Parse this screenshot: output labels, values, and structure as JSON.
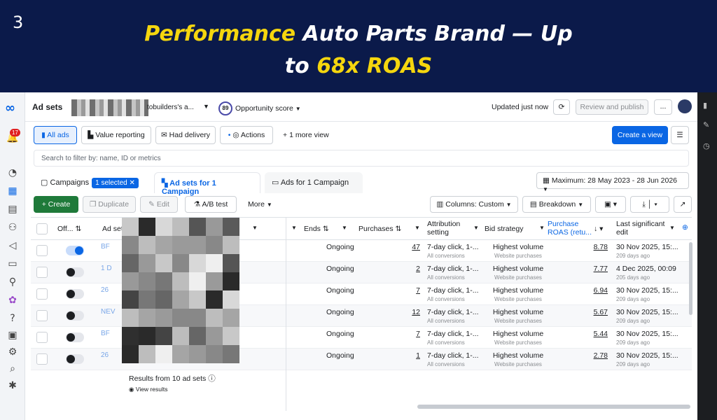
{
  "banner": {
    "slide_number": "3",
    "headline_part1": "Performance",
    "headline_part2": " Auto Parts Brand — Up",
    "headline_part3": "to ",
    "headline_part4": "68x ROAS",
    "highlight_color": "#f5d60e"
  },
  "nav": {
    "notification_count": "17"
  },
  "topbar": {
    "title": "Ad sets",
    "account_text": "tobuilders's a...",
    "opportunity_score_value": "89",
    "opportunity_score_label": "Opportunity score",
    "updated_text": "Updated just now",
    "review_publish_label": "Review and publish",
    "more_label": "..."
  },
  "views": {
    "all_ads": "All ads",
    "value_reporting": "Value reporting",
    "had_delivery": "Had delivery",
    "actions": "Actions",
    "more_view": "1 more view",
    "create_view": "Create a view"
  },
  "search": {
    "placeholder": "Search to filter by: name, ID or metrics"
  },
  "tabs": {
    "campaigns": "Campaigns",
    "campaigns_chip": "1 selected",
    "adsets": "Ad sets for 1 Campaign",
    "ads": "Ads for 1 Campaign"
  },
  "date_range": "Maximum: 28 May 2023 - 28 Jun 2026",
  "toolbar": {
    "create": "Create",
    "duplicate": "Duplicate",
    "edit": "Edit",
    "ab_test": "A/B test",
    "more": "More",
    "columns": "Columns: Custom",
    "breakdown": "Breakdown"
  },
  "columns": {
    "off_on": "Off...",
    "adset": "Ad set",
    "ends": "Ends",
    "purchases": "Purchases",
    "attribution_line1": "Attribution",
    "attribution_line2": "setting",
    "bid_strategy": "Bid strategy",
    "roas_line1": "Purchase",
    "roas_line2": "ROAS (retu...",
    "last_edit_line1": "Last significant",
    "last_edit_line2": "edit"
  },
  "rows": [
    {
      "name": "BF",
      "on": true,
      "ends": "Ongoing",
      "purchases": "47",
      "attribution": "7-day click, 1-...",
      "attribution_sub": "All conversions",
      "bid": "Highest volume",
      "bid_sub": "Website purchases",
      "roas": "8.78",
      "edit": "30 Nov 2025, 15:...",
      "edit_sub": "209 days ago"
    },
    {
      "name": "1 D",
      "on": false,
      "ends": "Ongoing",
      "purchases": "2",
      "attribution": "7-day click, 1-...",
      "attribution_sub": "All conversions",
      "bid": "Highest volume",
      "bid_sub": "Website purchases",
      "roas": "7.77",
      "edit": "4 Dec 2025, 00:09",
      "edit_sub": "205 days ago"
    },
    {
      "name": "26",
      "on": false,
      "ends": "Ongoing",
      "purchases": "7",
      "attribution": "7-day click, 1-...",
      "attribution_sub": "All conversions",
      "bid": "Highest volume",
      "bid_sub": "Website purchases",
      "roas": "6.94",
      "edit": "30 Nov 2025, 15:...",
      "edit_sub": "209 days ago"
    },
    {
      "name": "NEV",
      "on": false,
      "ends": "Ongoing",
      "purchases": "12",
      "attribution": "7-day click, 1-...",
      "attribution_sub": "All conversions",
      "bid": "Highest volume",
      "bid_sub": "Website purchases",
      "roas": "5.67",
      "edit": "30 Nov 2025, 15:...",
      "edit_sub": "209 days ago"
    },
    {
      "name": "BF",
      "on": false,
      "ends": "Ongoing",
      "purchases": "7",
      "attribution": "7-day click, 1-...",
      "attribution_sub": "All conversions",
      "bid": "Highest volume",
      "bid_sub": "Website purchases",
      "roas": "5.44",
      "edit": "30 Nov 2025, 15:...",
      "edit_sub": "209 days ago"
    },
    {
      "name": "26",
      "on": false,
      "ends": "Ongoing",
      "purchases": "1",
      "attribution": "7-day click, 1-...",
      "attribution_sub": "All conversions",
      "bid": "Highest volume",
      "bid_sub": "Website purchases",
      "roas": "2.78",
      "edit": "30 Nov 2025, 15:...",
      "edit_sub": "209 days ago"
    }
  ],
  "results": {
    "text": "Results from 10 ad sets",
    "view": "View results"
  }
}
